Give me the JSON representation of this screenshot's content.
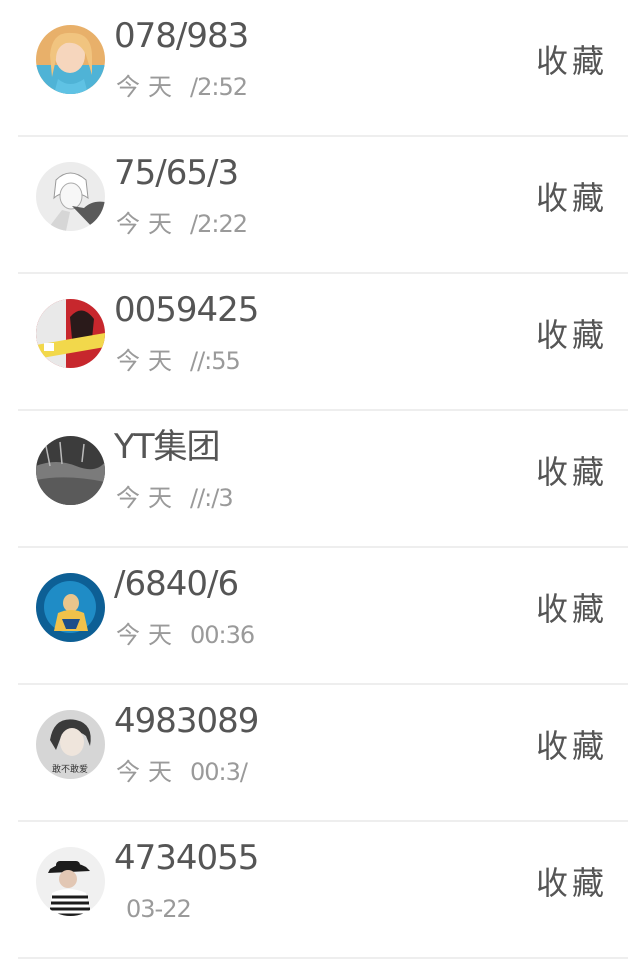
{
  "items": [
    {
      "name": "078/983",
      "day": "今天",
      "time": "/2:52",
      "action": "收藏",
      "avatar_icon": "girl-portrait-avatar",
      "avatar_colors": [
        "#f2c27a",
        "#5fb8d8"
      ]
    },
    {
      "name": "75/65/3",
      "day": "今天",
      "time": "/2:22",
      "action": "收藏",
      "avatar_icon": "anime-sketch-avatar",
      "avatar_colors": [
        "#e9e9e9",
        "#6b6b6b"
      ]
    },
    {
      "name": "0059425",
      "day": "今天",
      "time": "//:55",
      "action": "收藏",
      "avatar_icon": "red-poster-avatar",
      "avatar_colors": [
        "#c8262b",
        "#f3d94a"
      ]
    },
    {
      "name": "YT集团",
      "day": "今天",
      "time": "//:/3",
      "action": "收藏",
      "avatar_icon": "dark-landscape-avatar",
      "avatar_colors": [
        "#4a4a4a",
        "#9a9a9a"
      ]
    },
    {
      "name": "/6840/6",
      "day": "今天",
      "time": "00:36",
      "action": "收藏",
      "avatar_icon": "blue-figure-avatar",
      "avatar_colors": [
        "#0f6fa8",
        "#4cc4e6"
      ]
    },
    {
      "name": "4983089",
      "day": "今天",
      "time": "00:3/",
      "action": "收藏",
      "avatar_icon": "grey-portrait-avatar",
      "avatar_colors": [
        "#d8d8d8",
        "#444444"
      ],
      "avatar_caption": "敢不敢爱"
    },
    {
      "name": "4734055",
      "day": "",
      "time": "03-22",
      "action": "收藏",
      "avatar_icon": "hat-person-avatar",
      "avatar_colors": [
        "#f1f1f1",
        "#222222"
      ]
    }
  ]
}
